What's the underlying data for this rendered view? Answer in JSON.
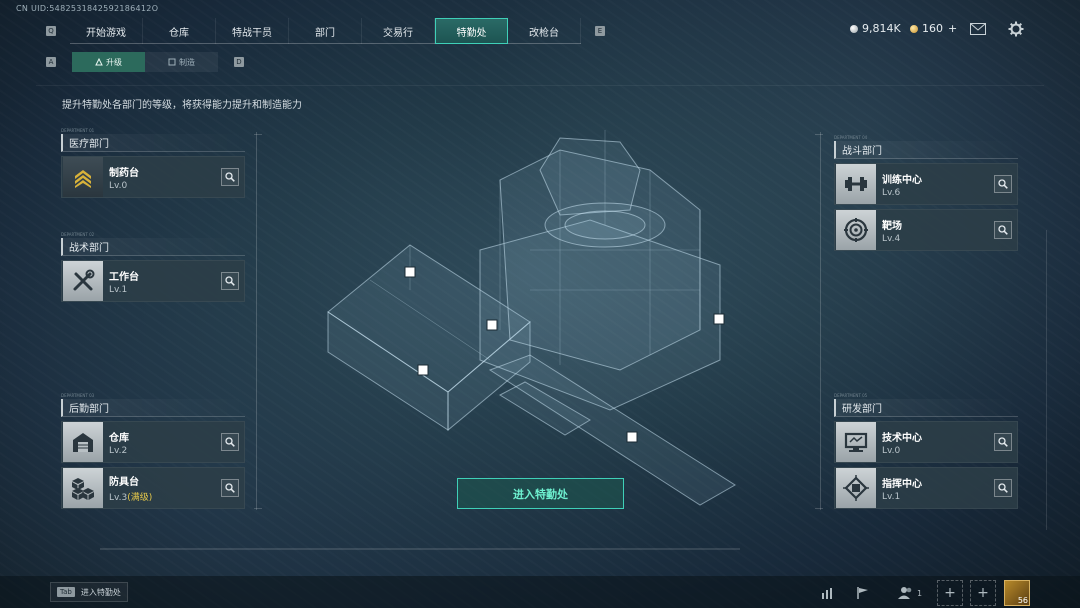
{
  "uid": "CN UID:5482531842592186412O",
  "nav": {
    "left_key": "Q",
    "right_key": "E",
    "tabs": [
      {
        "label": "开始游戏",
        "active": false
      },
      {
        "label": "仓库",
        "active": false
      },
      {
        "label": "特战干员",
        "active": false
      },
      {
        "label": "部门",
        "active": false
      },
      {
        "label": "交易行",
        "active": false
      },
      {
        "label": "特勤处",
        "active": true
      },
      {
        "label": "改枪台",
        "active": false
      }
    ]
  },
  "resources": {
    "currency": "9,814K",
    "currency_color": "#c8ced2",
    "premium": "160",
    "premium_color": "#e3b34a",
    "premium_add": "+"
  },
  "subnav": {
    "left_key": "A",
    "right_key": "D",
    "tabs": [
      {
        "label": "升级",
        "active": true,
        "icon": "upgrade-icon"
      },
      {
        "label": "制造",
        "active": false,
        "icon": "craft-icon"
      }
    ]
  },
  "description": "提升特勤处各部门的等级，将获得能力提升和制造能力",
  "departments": {
    "medical": {
      "tag": "DEPARTMENT 01",
      "name": "医疗部门",
      "facilities": [
        {
          "name": "制药台",
          "level": "Lv.0",
          "icon": "chevron-up-icon",
          "icon_color": "#d8b23a"
        }
      ]
    },
    "tactical": {
      "tag": "DEPARTMENT 02",
      "name": "战术部门",
      "facilities": [
        {
          "name": "工作台",
          "level": "Lv.1",
          "icon": "tools-icon"
        }
      ]
    },
    "logistics": {
      "tag": "DEPARTMENT 03",
      "name": "后勤部门",
      "facilities": [
        {
          "name": "仓库",
          "level": "Lv.2",
          "icon": "warehouse-icon"
        },
        {
          "name": "防具台",
          "level": "Lv.3",
          "level_max": "(满级)",
          "icon": "cubes-icon"
        }
      ]
    },
    "combat": {
      "tag": "DEPARTMENT 04",
      "name": "战斗部门",
      "facilities": [
        {
          "name": "训练中心",
          "level": "Lv.6",
          "icon": "dumbbell-icon"
        },
        {
          "name": "靶场",
          "level": "Lv.4",
          "icon": "target-icon"
        }
      ]
    },
    "research": {
      "tag": "DEPARTMENT 05",
      "name": "研发部门",
      "facilities": [
        {
          "name": "技术中心",
          "level": "Lv.0",
          "icon": "monitor-icon"
        },
        {
          "name": "指挥中心",
          "level": "Lv.1",
          "icon": "chip-icon"
        }
      ]
    }
  },
  "enter_button": "进入特勤处",
  "bottom": {
    "hint_key": "Tab",
    "hint_label": "进入特勤处",
    "friends_count": "1",
    "player_level": "56"
  },
  "accent_color": "#3fd0b8"
}
